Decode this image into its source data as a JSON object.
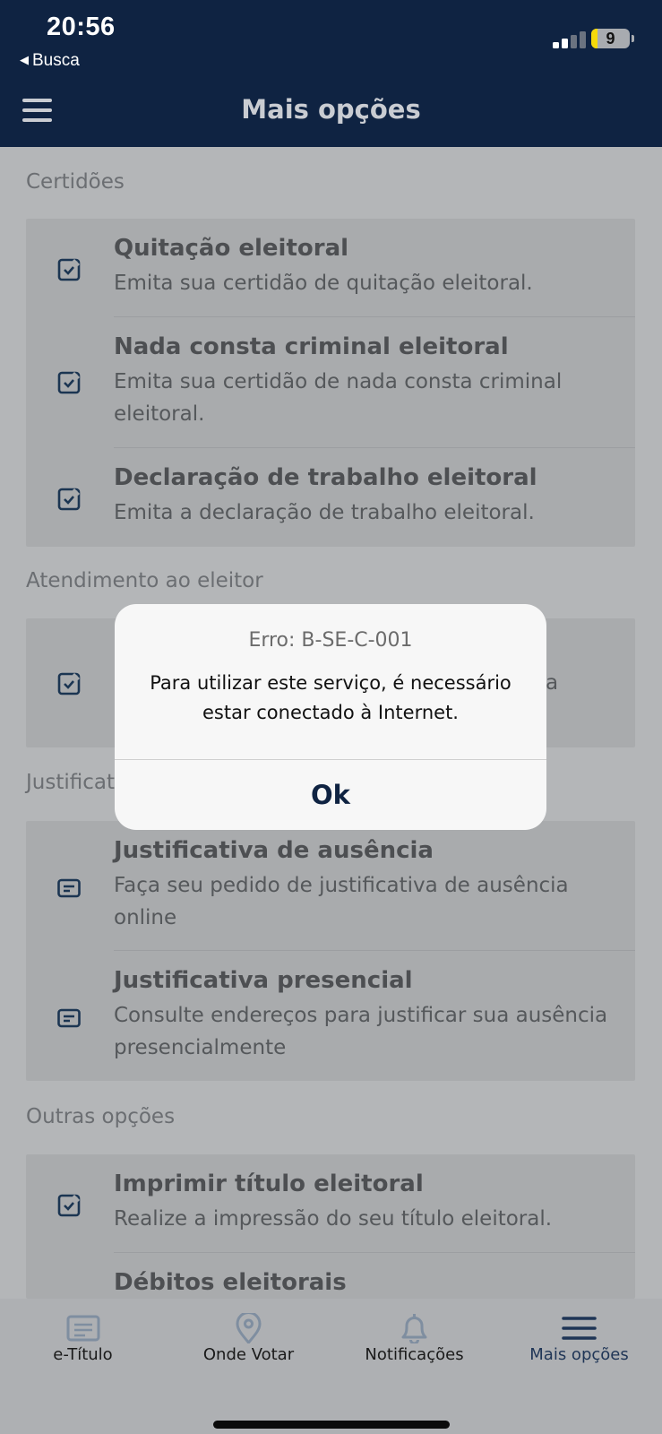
{
  "status_bar": {
    "time": "20:56",
    "back_label": "Busca",
    "battery": "9"
  },
  "header": {
    "title": "Mais opções"
  },
  "sections": {
    "certidoes": {
      "title": "Certidões",
      "items": [
        {
          "title": "Quitação eleitoral",
          "desc": "Emita sua certidão de quitação eleitoral.",
          "icon": "document-check-icon"
        },
        {
          "title": "Nada consta criminal eleitoral",
          "desc": "Emita sua certidão de nada consta criminal eleitoral.",
          "icon": "document-check-icon"
        },
        {
          "title": "Declaração de trabalho eleitoral",
          "desc": "Emita a declaração de trabalho eleitoral.",
          "icon": "document-check-icon"
        }
      ]
    },
    "atendimento": {
      "title": "Atendimento ao eleitor",
      "items": [
        {
          "partial_text": "a",
          "icon": "document-check-icon"
        }
      ]
    },
    "justificativa": {
      "title": "Justificat",
      "items": [
        {
          "title": "Justificativa de ausência",
          "desc": "Faça seu pedido de justificativa de ausência online",
          "icon": "card-text-icon"
        },
        {
          "title": "Justificativa presencial",
          "desc": "Consulte endereços para justificar sua ausência presencialmente",
          "icon": "card-text-icon"
        }
      ]
    },
    "outras": {
      "title": "Outras opções",
      "items": [
        {
          "title": "Imprimir título eleitoral",
          "desc": "Realize a impressão do seu título eleitoral.",
          "icon": "document-check-icon"
        },
        {
          "title": "Débitos eleitorais"
        }
      ]
    }
  },
  "dialog": {
    "error_code": "Erro: B-SE-C-001",
    "message": "Para utilizar este serviço, é necessário estar conectado à Internet.",
    "ok_label": "Ok"
  },
  "tabbar": {
    "tabs": [
      {
        "label": "e-Título",
        "icon": "id-card-icon"
      },
      {
        "label": "Onde Votar",
        "icon": "location-pin-icon"
      },
      {
        "label": "Notificações",
        "icon": "bell-icon"
      },
      {
        "label": "Mais opções",
        "icon": "menu-icon",
        "active": true
      }
    ]
  },
  "colors": {
    "header_bg": "#0f2342",
    "accent": "#0f2342"
  }
}
